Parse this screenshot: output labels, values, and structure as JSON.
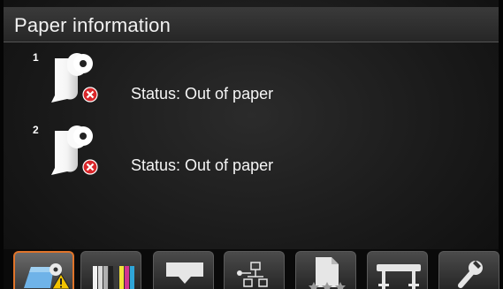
{
  "header": {
    "title": "Paper information"
  },
  "rolls": [
    {
      "number": "1",
      "status": "Status: Out of paper",
      "icon": "paper-roll-error-icon"
    },
    {
      "number": "2",
      "status": "Status: Out of paper",
      "icon": "paper-roll-error-icon"
    }
  ],
  "tabs": [
    {
      "name": "paper-tab",
      "icon": "paper-warning-icon",
      "active": true
    },
    {
      "name": "ink-tab",
      "icon": "ink-cartridges-icon",
      "active": false
    },
    {
      "name": "printhead-tab",
      "icon": "tray-icon",
      "active": false
    },
    {
      "name": "network-tab",
      "icon": "network-icon",
      "active": false
    },
    {
      "name": "jobs-tab",
      "icon": "job-queue-icon",
      "active": false
    },
    {
      "name": "printer-tab",
      "icon": "printer-icon",
      "active": false
    },
    {
      "name": "setup-tab",
      "icon": "wrench-icon",
      "active": false
    }
  ],
  "colors": {
    "active_tab_border": "#e0742a",
    "error": "#d9262a",
    "warning": "#f2c300"
  }
}
